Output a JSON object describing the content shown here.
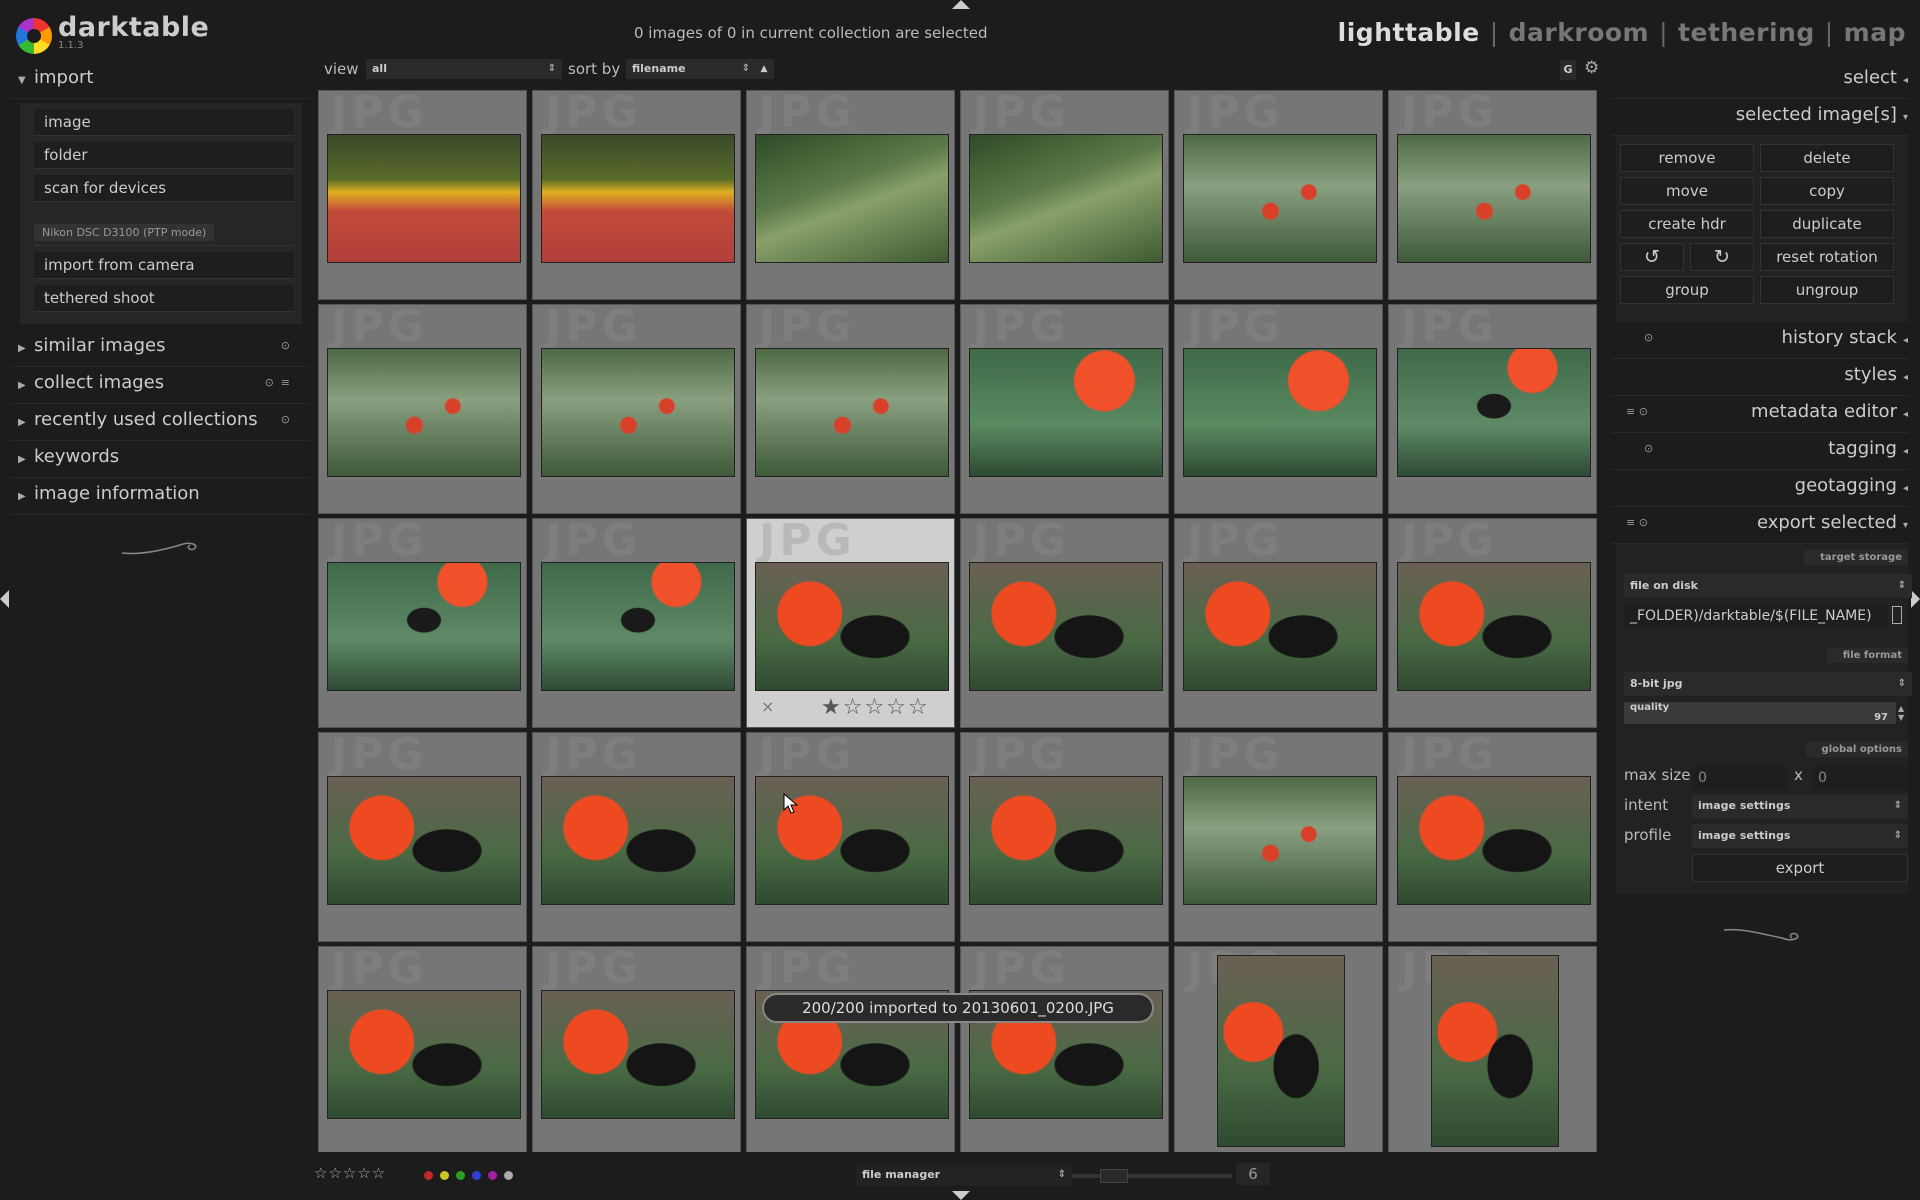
{
  "app": {
    "name": "darktable",
    "version": "1.1.3"
  },
  "header": {
    "selection_status": "0 images of 0 in current collection are selected",
    "views": {
      "lighttable": "lighttable",
      "darkroom": "darkroom",
      "tethering": "tethering",
      "map": "map",
      "separator": "|"
    }
  },
  "left": {
    "import": {
      "title": "import",
      "buttons": {
        "image": "image",
        "folder": "folder",
        "scan": "scan for devices"
      },
      "camera_label": "Nikon DSC D3100 (PTP mode)",
      "camera_buttons": {
        "import_from_camera": "import from camera",
        "tethered_shoot": "tethered shoot"
      }
    },
    "sections": {
      "similar_images": "similar images",
      "collect_images": "collect images",
      "recent_collections": "recently used collections",
      "keywords": "keywords",
      "image_information": "image information"
    }
  },
  "toolbar": {
    "view_label": "view",
    "view_value": "all",
    "sort_label": "sort by",
    "sort_value": "filename",
    "sort_dir": "▲",
    "grouping": "G"
  },
  "grid": {
    "watermark": "JPG",
    "columns": 6,
    "hovered_cell_index": 14,
    "thumbs": [
      {
        "scene": "butterfly-fruit",
        "orient": "landscape"
      },
      {
        "scene": "butterfly-fruit",
        "orient": "landscape"
      },
      {
        "scene": "glasswing-leaf",
        "orient": "landscape"
      },
      {
        "scene": "glasswing-leaf",
        "orient": "landscape"
      },
      {
        "scene": "bush-red-flowers",
        "orient": "landscape"
      },
      {
        "scene": "bush-red-flowers",
        "orient": "landscape"
      },
      {
        "scene": "bush-red-flowers",
        "orient": "landscape"
      },
      {
        "scene": "bush-red-flowers",
        "orient": "landscape"
      },
      {
        "scene": "bush-red-flowers",
        "orient": "landscape"
      },
      {
        "scene": "leaves-orange-flowers",
        "orient": "landscape"
      },
      {
        "scene": "leaves-orange-flowers",
        "orient": "landscape"
      },
      {
        "scene": "leaves-black-butterfly",
        "orient": "landscape"
      },
      {
        "scene": "leaves-black-butterfly",
        "orient": "landscape"
      },
      {
        "scene": "leaves-black-butterfly",
        "orient": "landscape"
      },
      {
        "scene": "black-butterfly-flowers",
        "orient": "landscape"
      },
      {
        "scene": "black-butterfly-flowers",
        "orient": "landscape"
      },
      {
        "scene": "black-butterfly-flowers",
        "orient": "landscape"
      },
      {
        "scene": "black-butterfly-flowers",
        "orient": "landscape"
      },
      {
        "scene": "black-butterfly-flowers",
        "orient": "landscape"
      },
      {
        "scene": "black-butterfly-flowers",
        "orient": "landscape"
      },
      {
        "scene": "black-butterfly-flowers",
        "orient": "landscape"
      },
      {
        "scene": "black-butterfly-flowers",
        "orient": "landscape"
      },
      {
        "scene": "bush-red-flowers",
        "orient": "landscape"
      },
      {
        "scene": "black-butterfly-flowers",
        "orient": "landscape"
      },
      {
        "scene": "black-butterfly-flowers",
        "orient": "landscape"
      },
      {
        "scene": "black-butterfly-flowers",
        "orient": "landscape"
      },
      {
        "scene": "black-butterfly-flowers",
        "orient": "landscape"
      },
      {
        "scene": "black-butterfly-flowers",
        "orient": "landscape"
      },
      {
        "scene": "black-butterfly-flowers",
        "orient": "portrait"
      },
      {
        "scene": "black-butterfly-flowers",
        "orient": "portrait"
      }
    ],
    "hover_reject": "×",
    "hover_stars": "★☆☆☆☆",
    "hover_rating": 1
  },
  "toast": "200/200 imported to 20130601_0200.JPG",
  "bottom": {
    "stars": "☆☆☆☆☆",
    "color_labels": [
      "#c0282a",
      "#c8c81e",
      "#2aa02a",
      "#3040d0",
      "#a020a0",
      "#aaaaaa"
    ],
    "layout_value": "file manager",
    "zoom_count": "6"
  },
  "right": {
    "select": "select",
    "selected_images": {
      "title": "selected image[s]",
      "remove": "remove",
      "delete": "delete",
      "move": "move",
      "copy": "copy",
      "create_hdr": "create hdr",
      "duplicate": "duplicate",
      "rotate_ccw": "↺",
      "rotate_cw": "↻",
      "reset_rotation": "reset rotation",
      "group": "group",
      "ungroup": "ungroup"
    },
    "history_stack": "history stack",
    "styles": "styles",
    "metadata_editor": "metadata editor",
    "tagging": "tagging",
    "geotagging": "geotagging",
    "export": {
      "title": "export selected",
      "target_storage_label": "target storage",
      "storage_value": "file on disk",
      "path_value": "_FOLDER)/darktable/$(FILE_NAME)",
      "file_format_label": "file format",
      "format_value": "8-bit jpg",
      "quality_label": "quality",
      "quality_value": "97",
      "global_options_label": "global options",
      "max_size_label": "max size",
      "max_w": "0",
      "times": "x",
      "max_h": "0",
      "intent_label": "intent",
      "intent_value": "image settings",
      "profile_label": "profile",
      "profile_value": "image settings",
      "export_button": "export"
    }
  }
}
